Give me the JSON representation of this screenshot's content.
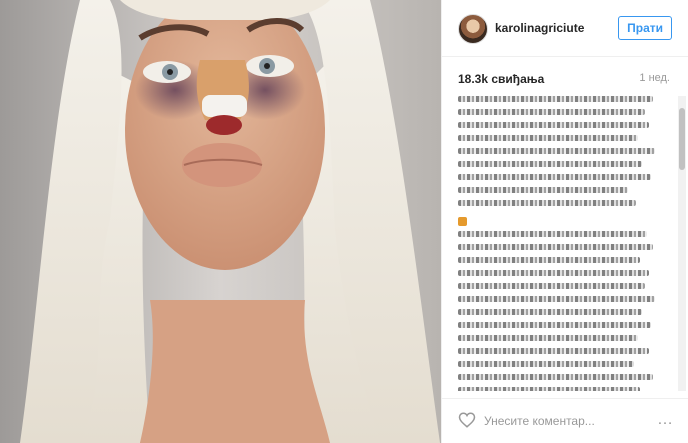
{
  "post": {
    "username": "karolinagriciute",
    "follow_label": "Прати",
    "likes": "18.3k свиђања",
    "time": "1 нед.",
    "comment_placeholder": "Унесите коментар...",
    "more_label": "…"
  },
  "icons": {
    "heart": "heart-icon",
    "more": "more-options-icon",
    "avatar": "avatar"
  },
  "colors": {
    "accent": "#3897f0",
    "text": "#262626",
    "muted": "#999999"
  }
}
